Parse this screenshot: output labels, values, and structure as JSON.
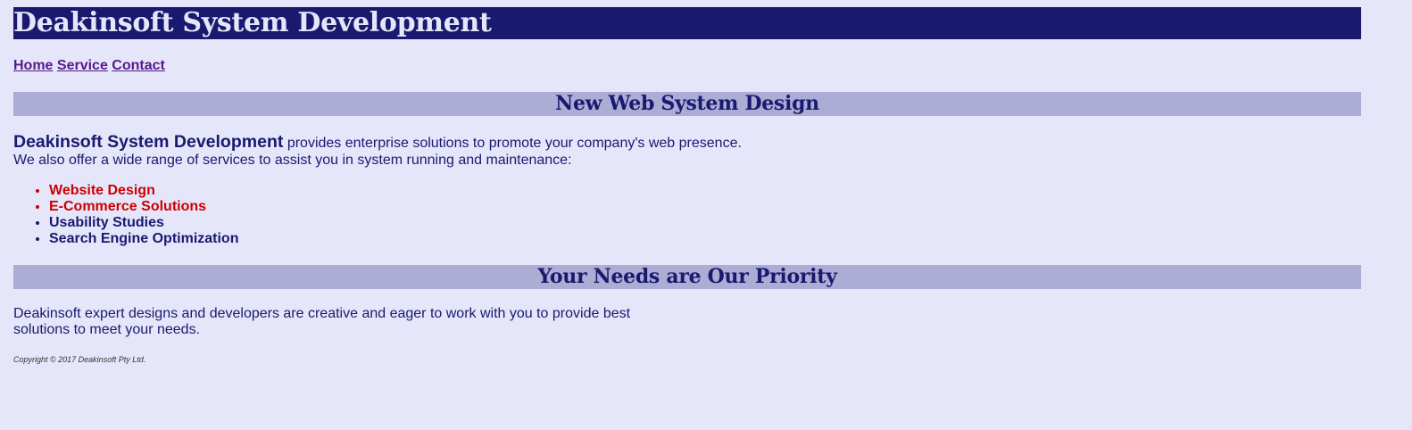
{
  "header": {
    "title": "Deakinsoft System Development"
  },
  "nav": {
    "items": [
      {
        "label": "Home"
      },
      {
        "label": "Service"
      },
      {
        "label": "Contact"
      }
    ]
  },
  "sections": [
    {
      "heading": "New Web System Design"
    },
    {
      "heading": "Your Needs are Our Priority"
    }
  ],
  "intro": {
    "company": "Deakinsoft System Development",
    "line1_rest": "provides enterprise solutions to promote your company's web presence.",
    "line2": "We also offer a wide range of services to assist you in system running and maintenance:"
  },
  "services": [
    {
      "label": "Website Design",
      "highlighted": true
    },
    {
      "label": "E-Commerce Solutions",
      "highlighted": true
    },
    {
      "label": "Usability Studies",
      "highlighted": false
    },
    {
      "label": "Search Engine Optimization",
      "highlighted": false
    }
  ],
  "needs": {
    "text": "Deakinsoft expert designs and developers are creative and eager to work with you to provide best solutions to meet your needs."
  },
  "footer": {
    "copyright": "Copyright © 2017 Deakinsoft Pty Ltd."
  },
  "colors": {
    "background": "#e6e6fa",
    "header_bg": "#191970",
    "section_bg": "#acacd5",
    "highlight": "#cc0000",
    "link": "#551a8b"
  }
}
